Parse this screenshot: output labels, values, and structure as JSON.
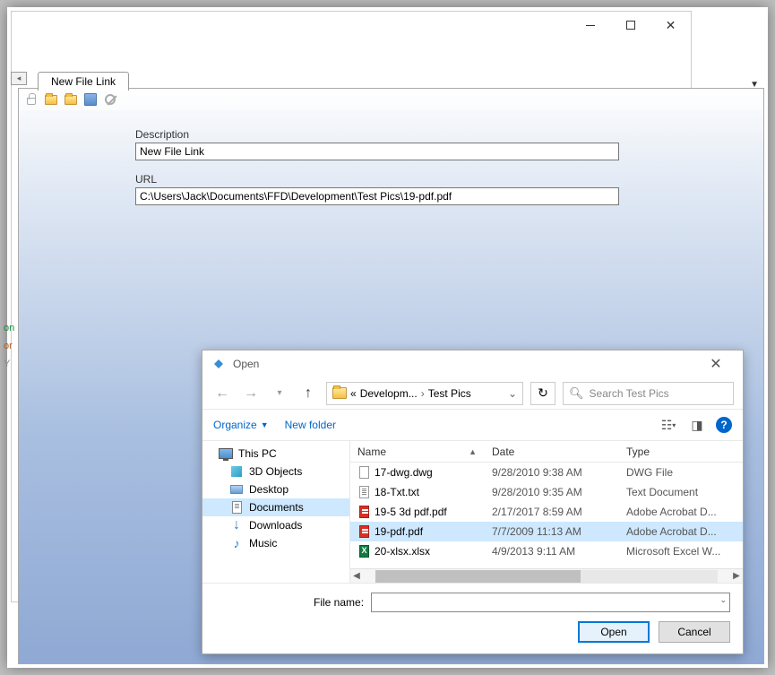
{
  "tab": {
    "title": "New File Link"
  },
  "form": {
    "description_label": "Description",
    "description_value": "New File Link",
    "url_label": "URL",
    "url_value": "C:\\Users\\Jack\\Documents\\FFD\\Development\\Test Pics\\19-pdf.pdf"
  },
  "sidehints": {
    "a": "on",
    "b": "or",
    "c": "Y"
  },
  "dialog": {
    "title": "Open",
    "breadcrumb": {
      "prefix": "«",
      "part1": "Developm...",
      "part2": "Test Pics"
    },
    "search_placeholder": "Search Test Pics",
    "organize": "Organize",
    "newfolder": "New folder",
    "nav": [
      {
        "label": "This PC",
        "icon": "pc",
        "indent": false,
        "selected": false
      },
      {
        "label": "3D Objects",
        "icon": "cube",
        "indent": true,
        "selected": false
      },
      {
        "label": "Desktop",
        "icon": "desktop",
        "indent": true,
        "selected": false
      },
      {
        "label": "Documents",
        "icon": "doc",
        "indent": true,
        "selected": true
      },
      {
        "label": "Downloads",
        "icon": "download",
        "indent": true,
        "selected": false
      },
      {
        "label": "Music",
        "icon": "music",
        "indent": true,
        "selected": false
      }
    ],
    "columns": {
      "name": "Name",
      "date": "Date",
      "type": "Type"
    },
    "files": [
      {
        "name": "17-dwg.dwg",
        "date": "9/28/2010 9:38 AM",
        "type": "DWG File",
        "icon": "generic",
        "selected": false
      },
      {
        "name": "18-Txt.txt",
        "date": "9/28/2010 9:35 AM",
        "type": "Text Document",
        "icon": "txt",
        "selected": false
      },
      {
        "name": "19-5 3d pdf.pdf",
        "date": "2/17/2017 8:59 AM",
        "type": "Adobe Acrobat D...",
        "icon": "pdf",
        "selected": false
      },
      {
        "name": "19-pdf.pdf",
        "date": "7/7/2009 11:13 AM",
        "type": "Adobe Acrobat D...",
        "icon": "pdf",
        "selected": true
      },
      {
        "name": "20-xlsx.xlsx",
        "date": "4/9/2013 9:11 AM",
        "type": "Microsoft Excel W...",
        "icon": "xlsx",
        "selected": false
      }
    ],
    "filename_label": "File name:",
    "filename_value": "",
    "open_btn": "Open",
    "cancel_btn": "Cancel"
  }
}
